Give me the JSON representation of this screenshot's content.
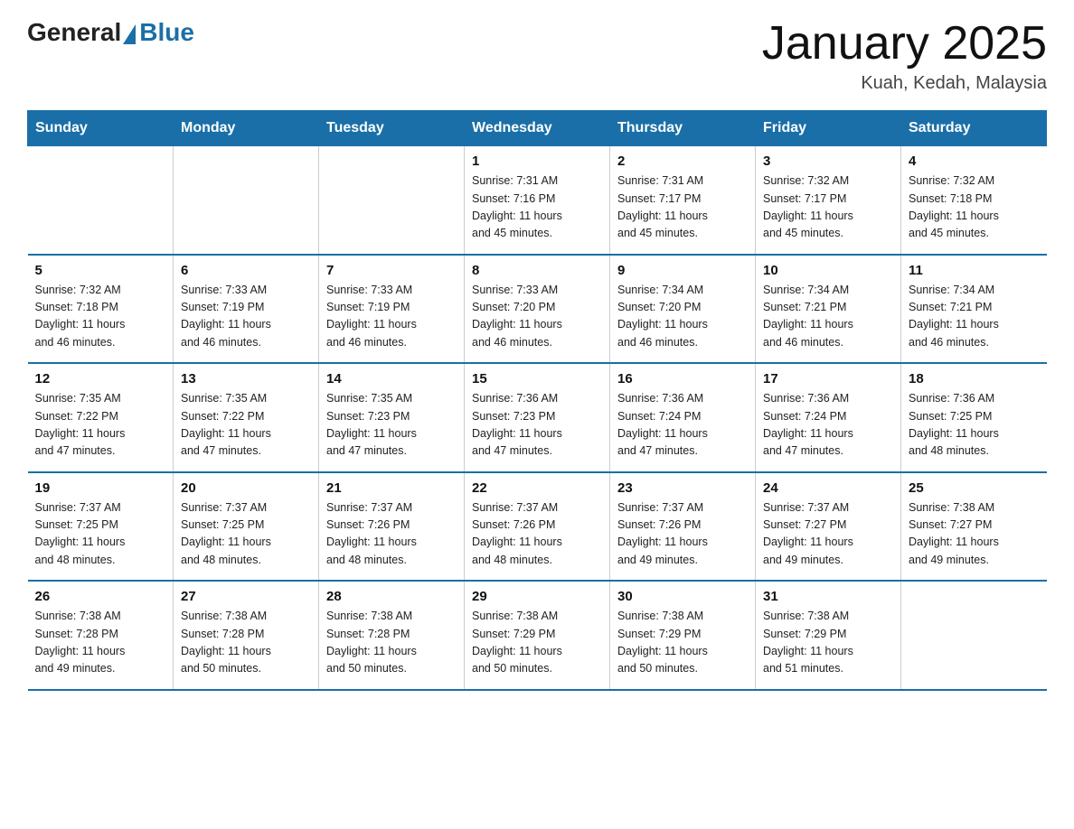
{
  "logo": {
    "general": "General",
    "blue": "Blue"
  },
  "title": "January 2025",
  "subtitle": "Kuah, Kedah, Malaysia",
  "days_header": [
    "Sunday",
    "Monday",
    "Tuesday",
    "Wednesday",
    "Thursday",
    "Friday",
    "Saturday"
  ],
  "weeks": [
    [
      {
        "day": "",
        "info": ""
      },
      {
        "day": "",
        "info": ""
      },
      {
        "day": "",
        "info": ""
      },
      {
        "day": "1",
        "info": "Sunrise: 7:31 AM\nSunset: 7:16 PM\nDaylight: 11 hours\nand 45 minutes."
      },
      {
        "day": "2",
        "info": "Sunrise: 7:31 AM\nSunset: 7:17 PM\nDaylight: 11 hours\nand 45 minutes."
      },
      {
        "day": "3",
        "info": "Sunrise: 7:32 AM\nSunset: 7:17 PM\nDaylight: 11 hours\nand 45 minutes."
      },
      {
        "day": "4",
        "info": "Sunrise: 7:32 AM\nSunset: 7:18 PM\nDaylight: 11 hours\nand 45 minutes."
      }
    ],
    [
      {
        "day": "5",
        "info": "Sunrise: 7:32 AM\nSunset: 7:18 PM\nDaylight: 11 hours\nand 46 minutes."
      },
      {
        "day": "6",
        "info": "Sunrise: 7:33 AM\nSunset: 7:19 PM\nDaylight: 11 hours\nand 46 minutes."
      },
      {
        "day": "7",
        "info": "Sunrise: 7:33 AM\nSunset: 7:19 PM\nDaylight: 11 hours\nand 46 minutes."
      },
      {
        "day": "8",
        "info": "Sunrise: 7:33 AM\nSunset: 7:20 PM\nDaylight: 11 hours\nand 46 minutes."
      },
      {
        "day": "9",
        "info": "Sunrise: 7:34 AM\nSunset: 7:20 PM\nDaylight: 11 hours\nand 46 minutes."
      },
      {
        "day": "10",
        "info": "Sunrise: 7:34 AM\nSunset: 7:21 PM\nDaylight: 11 hours\nand 46 minutes."
      },
      {
        "day": "11",
        "info": "Sunrise: 7:34 AM\nSunset: 7:21 PM\nDaylight: 11 hours\nand 46 minutes."
      }
    ],
    [
      {
        "day": "12",
        "info": "Sunrise: 7:35 AM\nSunset: 7:22 PM\nDaylight: 11 hours\nand 47 minutes."
      },
      {
        "day": "13",
        "info": "Sunrise: 7:35 AM\nSunset: 7:22 PM\nDaylight: 11 hours\nand 47 minutes."
      },
      {
        "day": "14",
        "info": "Sunrise: 7:35 AM\nSunset: 7:23 PM\nDaylight: 11 hours\nand 47 minutes."
      },
      {
        "day": "15",
        "info": "Sunrise: 7:36 AM\nSunset: 7:23 PM\nDaylight: 11 hours\nand 47 minutes."
      },
      {
        "day": "16",
        "info": "Sunrise: 7:36 AM\nSunset: 7:24 PM\nDaylight: 11 hours\nand 47 minutes."
      },
      {
        "day": "17",
        "info": "Sunrise: 7:36 AM\nSunset: 7:24 PM\nDaylight: 11 hours\nand 47 minutes."
      },
      {
        "day": "18",
        "info": "Sunrise: 7:36 AM\nSunset: 7:25 PM\nDaylight: 11 hours\nand 48 minutes."
      }
    ],
    [
      {
        "day": "19",
        "info": "Sunrise: 7:37 AM\nSunset: 7:25 PM\nDaylight: 11 hours\nand 48 minutes."
      },
      {
        "day": "20",
        "info": "Sunrise: 7:37 AM\nSunset: 7:25 PM\nDaylight: 11 hours\nand 48 minutes."
      },
      {
        "day": "21",
        "info": "Sunrise: 7:37 AM\nSunset: 7:26 PM\nDaylight: 11 hours\nand 48 minutes."
      },
      {
        "day": "22",
        "info": "Sunrise: 7:37 AM\nSunset: 7:26 PM\nDaylight: 11 hours\nand 48 minutes."
      },
      {
        "day": "23",
        "info": "Sunrise: 7:37 AM\nSunset: 7:26 PM\nDaylight: 11 hours\nand 49 minutes."
      },
      {
        "day": "24",
        "info": "Sunrise: 7:37 AM\nSunset: 7:27 PM\nDaylight: 11 hours\nand 49 minutes."
      },
      {
        "day": "25",
        "info": "Sunrise: 7:38 AM\nSunset: 7:27 PM\nDaylight: 11 hours\nand 49 minutes."
      }
    ],
    [
      {
        "day": "26",
        "info": "Sunrise: 7:38 AM\nSunset: 7:28 PM\nDaylight: 11 hours\nand 49 minutes."
      },
      {
        "day": "27",
        "info": "Sunrise: 7:38 AM\nSunset: 7:28 PM\nDaylight: 11 hours\nand 50 minutes."
      },
      {
        "day": "28",
        "info": "Sunrise: 7:38 AM\nSunset: 7:28 PM\nDaylight: 11 hours\nand 50 minutes."
      },
      {
        "day": "29",
        "info": "Sunrise: 7:38 AM\nSunset: 7:29 PM\nDaylight: 11 hours\nand 50 minutes."
      },
      {
        "day": "30",
        "info": "Sunrise: 7:38 AM\nSunset: 7:29 PM\nDaylight: 11 hours\nand 50 minutes."
      },
      {
        "day": "31",
        "info": "Sunrise: 7:38 AM\nSunset: 7:29 PM\nDaylight: 11 hours\nand 51 minutes."
      },
      {
        "day": "",
        "info": ""
      }
    ]
  ]
}
